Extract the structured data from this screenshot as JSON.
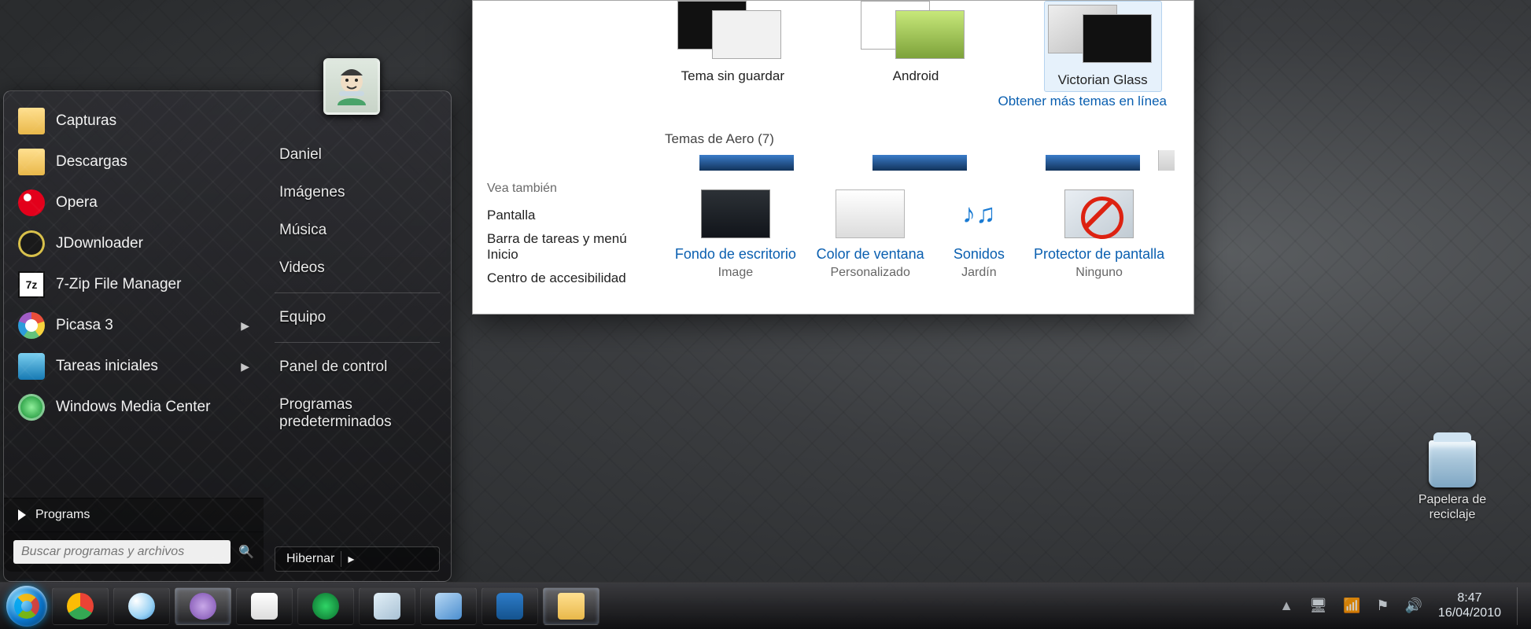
{
  "desktop": {
    "recycle_label": "Papelera de reciclaje"
  },
  "startmenu": {
    "apps": [
      {
        "label": "Capturas",
        "icon": "folder",
        "arrow": false
      },
      {
        "label": "Descargas",
        "icon": "folder",
        "arrow": false
      },
      {
        "label": "Opera",
        "icon": "opera",
        "arrow": false
      },
      {
        "label": "JDownloader",
        "icon": "jd",
        "arrow": false
      },
      {
        "label": "7-Zip File Manager",
        "icon": "7z",
        "arrow": false
      },
      {
        "label": "Picasa 3",
        "icon": "picasa",
        "arrow": true
      },
      {
        "label": "Tareas iniciales",
        "icon": "tareas",
        "arrow": true
      },
      {
        "label": "Windows Media Center",
        "icon": "wmc",
        "arrow": false
      }
    ],
    "all_programs": "Programs",
    "search_placeholder": "Buscar programas y archivos",
    "right": [
      "Daniel",
      "Imágenes",
      "Música",
      "Videos",
      "—",
      "Equipo",
      "—",
      "Panel de control",
      "Programas predeterminados"
    ],
    "power_label": "Hibernar"
  },
  "personalize": {
    "themes": [
      {
        "label": "Tema sin guardar",
        "style": "white"
      },
      {
        "label": "Android",
        "style": "green"
      },
      {
        "label": "Victorian Glass",
        "style": "glass",
        "selected": true
      }
    ],
    "more_online": "Obtener más temas en línea",
    "aero_header": "Temas de Aero (7)",
    "side_header": "Vea también",
    "side_links": [
      "Pantalla",
      "Barra de tareas y menú Inicio",
      "Centro de accesibilidad"
    ],
    "bottom": [
      {
        "caption": "Fondo de escritorio",
        "sub": "Image",
        "icon": "wallpaper"
      },
      {
        "caption": "Color de ventana",
        "sub": "Personalizado",
        "icon": "colorwin"
      },
      {
        "caption": "Sonidos",
        "sub": "Jardín",
        "icon": "sounds"
      },
      {
        "caption": "Protector de pantalla",
        "sub": "Ninguno",
        "icon": "saver"
      }
    ]
  },
  "taskbar": {
    "clock_time": "8:47",
    "clock_date": "16/04/2010"
  }
}
